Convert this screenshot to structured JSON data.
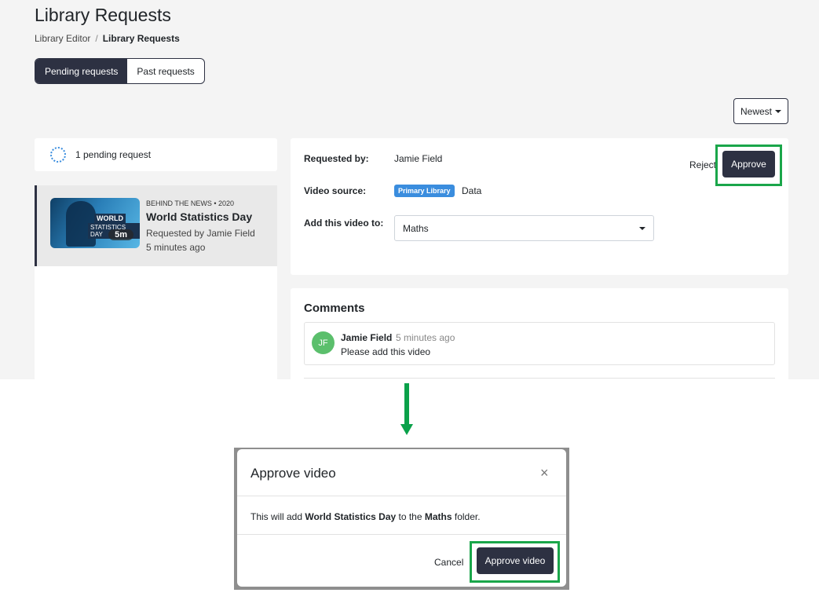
{
  "page": {
    "title": "Library Requests",
    "breadcrumb": {
      "parent": "Library Editor",
      "separator": "/",
      "current": "Library Requests"
    }
  },
  "tabs": [
    {
      "label": "Pending requests",
      "active": true
    },
    {
      "label": "Past requests",
      "active": false
    }
  ],
  "sort": {
    "label": "Newest"
  },
  "pending": {
    "text": "1 pending request"
  },
  "list": {
    "items": [
      {
        "meta": "BEHIND THE NEWS • 2020",
        "title": "World Statistics Day",
        "requested_by": "Requested by Jamie Field",
        "time": "5 minutes ago",
        "thumb_title": "WORLD",
        "thumb_sub": "STATISTICS DAY",
        "duration": "5m"
      }
    ]
  },
  "detail": {
    "requested_by_label": "Requested by:",
    "requested_by_value": "Jamie Field",
    "video_source_label": "Video source:",
    "video_source_badge": "Primary Library",
    "video_source_value": "Data",
    "add_to_label": "Add this video to:",
    "add_to_value": "Maths",
    "reject_label": "Reject",
    "approve_label": "Approve"
  },
  "comments": {
    "heading": "Comments",
    "items": [
      {
        "initials": "JF",
        "author": "Jamie Field",
        "time": "5 minutes ago",
        "text": "Please add this video"
      }
    ]
  },
  "modal": {
    "title": "Approve video",
    "close": "×",
    "body_prefix": "This will add ",
    "body_video": "World Statistics Day",
    "body_middle": " to the ",
    "body_folder": "Maths",
    "body_suffix": " folder.",
    "cancel_label": "Cancel",
    "approve_label": "Approve video"
  },
  "colors": {
    "primary_dark": "#2d3142",
    "highlight_green": "#1aa64a",
    "badge_blue": "#3a8dde",
    "avatar_green": "#5bbf6c",
    "arrow_green": "#0aa14a"
  }
}
